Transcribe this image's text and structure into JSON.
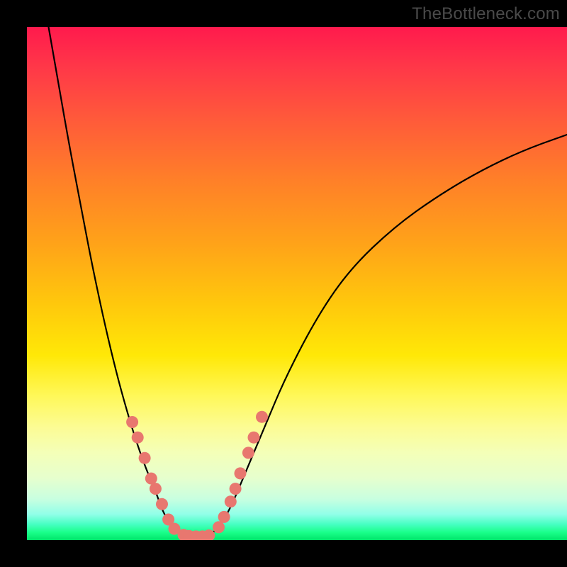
{
  "watermark": "TheBottleneck.com",
  "colors": {
    "curve": "#000000",
    "dot_fill": "#e8776f",
    "dot_stroke": "#c04a42"
  },
  "chart_data": {
    "type": "line",
    "title": "",
    "xlabel": "",
    "ylabel": "",
    "xlim": [
      0,
      100
    ],
    "ylim": [
      0,
      100
    ],
    "note": "Axes have no visible numeric tick labels; values below are pixel-derived estimates on a 0–100 normalized scale where (0,0) is bottom-left of the colored plot area.",
    "series": [
      {
        "name": "left-branch",
        "x": [
          4,
          6,
          8,
          10,
          12,
          14,
          16,
          18,
          20,
          22,
          24,
          25,
          26,
          27,
          28,
          29
        ],
        "y": [
          100,
          88,
          76,
          65,
          54,
          44,
          35,
          27,
          20,
          14,
          9,
          6,
          4,
          2.5,
          1.5,
          1
        ]
      },
      {
        "name": "flat-bottom",
        "x": [
          29,
          30,
          31,
          32,
          33,
          34
        ],
        "y": [
          1,
          0.8,
          0.7,
          0.7,
          0.8,
          1
        ]
      },
      {
        "name": "right-branch",
        "x": [
          34,
          36,
          38,
          40,
          44,
          48,
          54,
          60,
          68,
          76,
          84,
          92,
          100
        ],
        "y": [
          1,
          3,
          7,
          12,
          22,
          32,
          44,
          53,
          61,
          67,
          72,
          76,
          79
        ]
      }
    ],
    "markers_left": [
      {
        "x": 19.5,
        "y": 23
      },
      {
        "x": 20.5,
        "y": 20
      },
      {
        "x": 21.8,
        "y": 16
      },
      {
        "x": 23.0,
        "y": 12
      },
      {
        "x": 23.8,
        "y": 10
      },
      {
        "x": 25.0,
        "y": 7
      },
      {
        "x": 26.2,
        "y": 4
      },
      {
        "x": 27.3,
        "y": 2.2
      }
    ],
    "markers_bottom": [
      {
        "x": 29.0,
        "y": 1.0
      },
      {
        "x": 30.0,
        "y": 0.8
      },
      {
        "x": 31.3,
        "y": 0.7
      },
      {
        "x": 32.5,
        "y": 0.7
      },
      {
        "x": 33.7,
        "y": 0.9
      }
    ],
    "markers_right": [
      {
        "x": 35.5,
        "y": 2.5
      },
      {
        "x": 36.5,
        "y": 4.5
      },
      {
        "x": 37.7,
        "y": 7.5
      },
      {
        "x": 38.6,
        "y": 10
      },
      {
        "x": 39.5,
        "y": 13
      },
      {
        "x": 41.0,
        "y": 17
      },
      {
        "x": 42.0,
        "y": 20
      },
      {
        "x": 43.5,
        "y": 24
      }
    ]
  }
}
